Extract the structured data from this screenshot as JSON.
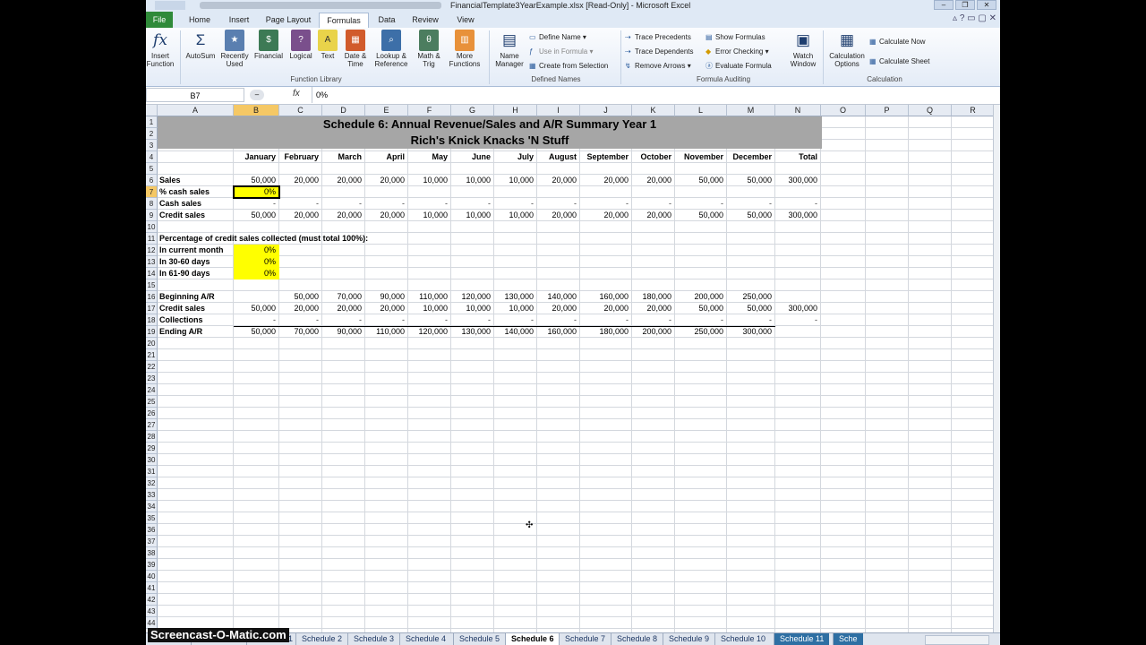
{
  "window": {
    "title": "FinancialTemplate3YearExample.xlsx  [Read-Only]  -  Microsoft Excel",
    "minimize": "–",
    "restore": "❐",
    "close": "✕"
  },
  "tabs": [
    "File",
    "Home",
    "Insert",
    "Page Layout",
    "Formulas",
    "Data",
    "Review",
    "View"
  ],
  "active_tab": "Formulas",
  "ribbon": {
    "insert_function": "Insert Function",
    "autosum": "AutoSum",
    "recently_used": "Recently Used",
    "financial": "Financial",
    "logical": "Logical",
    "text": "Text",
    "date_time": "Date & Time",
    "lookup_reference": "Lookup & Reference",
    "math_trig": "Math & Trig",
    "more_functions": "More Functions",
    "function_library": "Function Library",
    "name_manager": "Name Manager",
    "define_name": "Define Name",
    "use_in_formula": "Use in Formula",
    "create_from_selection": "Create from Selection",
    "defined_names": "Defined Names",
    "trace_precedents": "Trace Precedents",
    "trace_dependents": "Trace Dependents",
    "remove_arrows": "Remove Arrows",
    "show_formulas": "Show Formulas",
    "error_checking": "Error Checking",
    "evaluate_formula": "Evaluate Formula",
    "watch_window": "Watch Window",
    "formula_auditing": "Formula Auditing",
    "calculation_options": "Calculation Options",
    "calculate_now": "Calculate Now",
    "calculate_sheet": "Calculate Sheet",
    "calculation": "Calculation"
  },
  "formula_bar": {
    "name_box": "B7",
    "fx": "fx",
    "value": "0%"
  },
  "columns": [
    "A",
    "B",
    "C",
    "D",
    "E",
    "F",
    "G",
    "H",
    "I",
    "J",
    "K",
    "L",
    "M",
    "N",
    "O",
    "P",
    "Q",
    "R"
  ],
  "sheet": {
    "title1": "Schedule 6: Annual Revenue/Sales and A/R Summary Year 1",
    "title2": "Rich's Knick Knacks 'N Stuff",
    "months": [
      "January",
      "February",
      "March",
      "April",
      "May",
      "June",
      "July",
      "August",
      "September",
      "October",
      "November",
      "December",
      "Total"
    ],
    "sales_label": "Sales",
    "sales": [
      "50,000",
      "20,000",
      "20,000",
      "20,000",
      "10,000",
      "10,000",
      "10,000",
      "20,000",
      "20,000",
      "20,000",
      "50,000",
      "50,000",
      "300,000"
    ],
    "pct_cash_label": "% cash sales",
    "pct_cash": "0%",
    "cash_sales_label": "Cash sales",
    "cash_sales": [
      "-",
      "-",
      "-",
      "-",
      "-",
      "-",
      "-",
      "-",
      "-",
      "-",
      "-",
      "-",
      "-"
    ],
    "credit_sales_label": "Credit sales",
    "credit_sales": [
      "50,000",
      "20,000",
      "20,000",
      "20,000",
      "10,000",
      "10,000",
      "10,000",
      "20,000",
      "20,000",
      "20,000",
      "50,000",
      "50,000",
      "300,000"
    ],
    "pct_collected_label": "Percentage of credit sales collected (must total 100%):",
    "current_month_label": "In current month",
    "current_month": "0%",
    "days_30_60_label": "In 30-60 days",
    "days_30_60": "0%",
    "days_61_90_label": "In 61-90 days",
    "days_61_90": "0%",
    "beginning_ar_label": "Beginning A/R",
    "beginning_ar": [
      "",
      "50,000",
      "70,000",
      "90,000",
      "110,000",
      "120,000",
      "130,000",
      "140,000",
      "160,000",
      "180,000",
      "200,000",
      "250,000",
      ""
    ],
    "credit_sales2_label": "Credit sales",
    "credit_sales2": [
      "50,000",
      "20,000",
      "20,000",
      "20,000",
      "10,000",
      "10,000",
      "10,000",
      "20,000",
      "20,000",
      "20,000",
      "50,000",
      "50,000",
      "300,000"
    ],
    "collections_label": "Collections",
    "collections": [
      "-",
      "-",
      "-",
      "-",
      "-",
      "-",
      "-",
      "-",
      "-",
      "-",
      "-",
      "-",
      "-"
    ],
    "ending_ar_label": "Ending A/R",
    "ending_ar": [
      "50,000",
      "70,000",
      "90,000",
      "110,000",
      "120,000",
      "130,000",
      "140,000",
      "160,000",
      "180,000",
      "200,000",
      "250,000",
      "300,000",
      ""
    ]
  },
  "sheet_tabs": [
    "Introduction",
    "Schedule 1",
    "Schedule 2",
    "Schedule 3",
    "Schedule 4",
    "Schedule 5",
    "Schedule 6",
    "Schedule 7",
    "Schedule 8",
    "Schedule 9",
    "Schedule 10",
    "Schedule 11",
    "Sche"
  ],
  "active_sheet": "Schedule 6",
  "watermark": "Screencast-O-Matic.com",
  "colors": {
    "yellow": "#ffff00",
    "banner": "#a6a6a6",
    "file_tab": "#2f8a39",
    "selection_header": "#f5c865"
  }
}
